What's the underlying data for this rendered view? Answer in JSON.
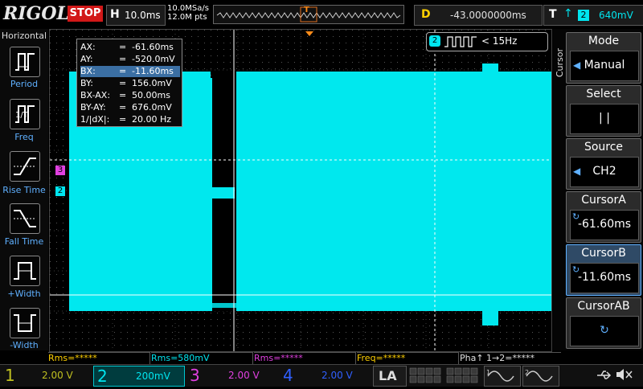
{
  "top": {
    "brand": "RIGOL",
    "run_state": "STOP",
    "h_label": "H",
    "timebase": "10.0ms",
    "sample_rate": "10.0MSa/s",
    "mem_depth": "12.0M pts",
    "trig_marker": "T",
    "delay_label": "D",
    "delay_value": "-43.0000000ms",
    "trig_label": "T",
    "trig_channel": "2",
    "trig_level": "640mV"
  },
  "left_panel": {
    "title": "Horizontal",
    "buttons": [
      "Period",
      "Freq",
      "Rise Time",
      "Fall Time",
      "+Width",
      "-Width"
    ]
  },
  "cursor_readout": {
    "rows": [
      {
        "name": "AX:",
        "eq": "=",
        "value": "-61.60ms"
      },
      {
        "name": "AY:",
        "eq": "=",
        "value": "-520.0mV"
      },
      {
        "name": "BX:",
        "eq": "=",
        "value": "-11.60ms"
      },
      {
        "name": "BY:",
        "eq": "=",
        "value": "156.0mV"
      },
      {
        "name": "BX-AX:",
        "eq": "=",
        "value": "50.00ms"
      },
      {
        "name": "BY-AY:",
        "eq": "=",
        "value": "676.0mV"
      },
      {
        "name": "1/|dX|:",
        "eq": "=",
        "value": "20.00 Hz"
      }
    ],
    "selected_row": 2
  },
  "freq_indicator": {
    "channel": "2",
    "text": "< 15Hz"
  },
  "grid_markers": {
    "ch3": "3",
    "ch2": "2"
  },
  "right_panel": {
    "side_label": "Cursor",
    "mode_title": "Mode",
    "mode_value": "Manual",
    "select_title": "Select",
    "select_value": "| |",
    "source_title": "Source",
    "source_value": "CH2",
    "cursora_title": "CursorA",
    "cursora_value": "-61.60ms",
    "cursorb_title": "CursorB",
    "cursorb_value": "-11.60ms",
    "cursorab_title": "CursorAB"
  },
  "measurements": [
    {
      "label": "Rms=*****",
      "color": "#ffd000"
    },
    {
      "label": "Rms=580mV",
      "color": "#00e5ef"
    },
    {
      "label": "Rms=*****",
      "color": "#e040e0"
    },
    {
      "label": "Freq=*****",
      "color": "#ffd000"
    },
    {
      "label": "Pha↑ 1→2=*****",
      "color": "#e0e0e0"
    }
  ],
  "channels": [
    {
      "num": "1",
      "value": "2.00 V",
      "color": "#c0c020"
    },
    {
      "num": "2",
      "value": "200mV",
      "color": "#00e5ef"
    },
    {
      "num": "3",
      "value": "2.00 V",
      "color": "#e040e0"
    },
    {
      "num": "4",
      "value": "2.00 V",
      "color": "#3060ff"
    }
  ],
  "la_label": "LA",
  "colors": {
    "ch1": "#c0c020",
    "ch2": "#00e5ef",
    "ch3": "#e040e0",
    "ch4": "#3060ff",
    "stop": "#d21818",
    "accent": "#3b6fa3"
  }
}
